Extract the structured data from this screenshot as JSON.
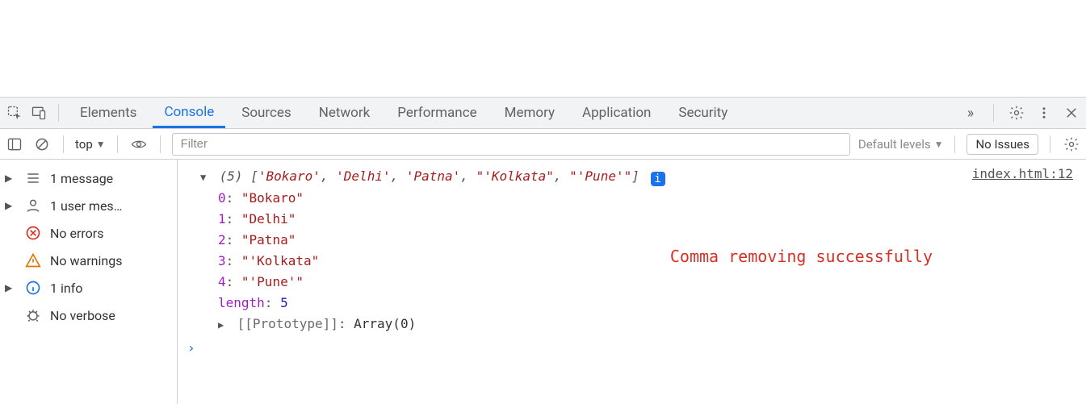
{
  "tabs": {
    "elements": "Elements",
    "console": "Console",
    "sources": "Sources",
    "network": "Network",
    "performance": "Performance",
    "memory": "Memory",
    "application": "Application",
    "security": "Security",
    "more": "»"
  },
  "toolbar": {
    "context": "top",
    "filter_placeholder": "Filter",
    "levels": "Default levels",
    "issues": "No Issues"
  },
  "sidebar": {
    "messages": "1 message",
    "user_messages": "1 user mes…",
    "no_errors": "No errors",
    "no_warnings": "No warnings",
    "info": "1 info",
    "no_verbose": "No verbose"
  },
  "console": {
    "source_link": "index.html:12",
    "summary_count": "(5)",
    "summary_bracket_open": "[",
    "summary_items": [
      "'Bokaro'",
      "'Delhi'",
      "'Patna'",
      "\"'Kolkata\"",
      "\"'Pune'\""
    ],
    "summary_bracket_close": "]",
    "info_glyph": "i",
    "entries": [
      {
        "index": "0",
        "value": "\"Bokaro\""
      },
      {
        "index": "1",
        "value": "\"Delhi\""
      },
      {
        "index": "2",
        "value": "\"Patna\""
      },
      {
        "index": "3",
        "value": "\"'Kolkata\""
      },
      {
        "index": "4",
        "value": "\"'Pune'\""
      }
    ],
    "length_key": "length",
    "length_val": "5",
    "proto_label": "[[Prototype]]",
    "proto_val": "Array(0)",
    "prompt": "›"
  },
  "annotation": "Comma removing successfully"
}
